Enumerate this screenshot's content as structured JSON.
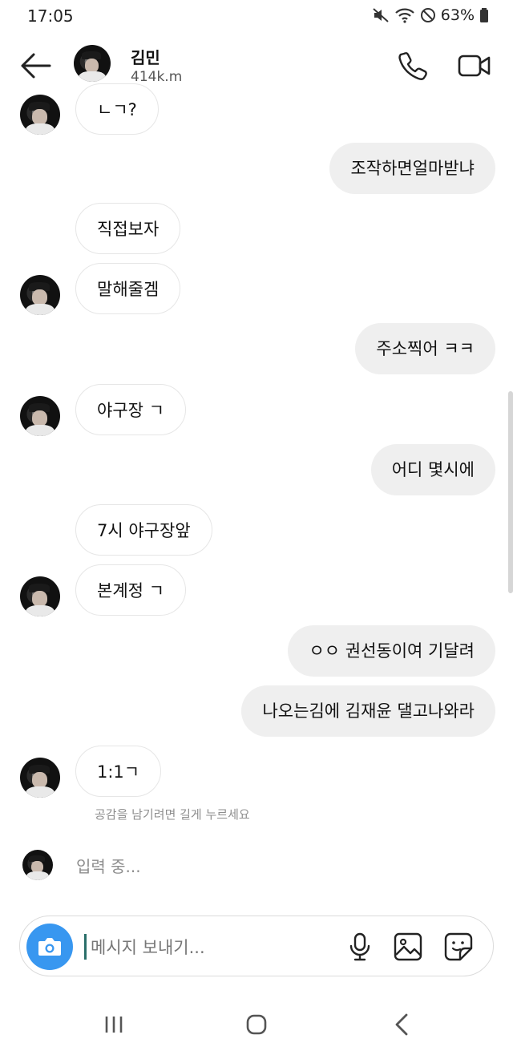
{
  "status": {
    "time": "17:05",
    "battery": "63%"
  },
  "header": {
    "name": "김민",
    "subtitle": "414k.m"
  },
  "messages": [
    {
      "dir": "in",
      "text": "ㄴㄱ?"
    },
    {
      "dir": "out",
      "text": "조작하면얼마받냐"
    },
    {
      "dir": "in",
      "text": "직접보자"
    },
    {
      "dir": "in",
      "text": "말해줄겜"
    },
    {
      "dir": "out",
      "text": "주소찍어 ㅋㅋ"
    },
    {
      "dir": "in",
      "text": "야구장 ㄱ"
    },
    {
      "dir": "out",
      "text": "어디 몇시에"
    },
    {
      "dir": "in",
      "text": "7시 야구장앞"
    },
    {
      "dir": "in",
      "text": "본계정 ㄱ"
    },
    {
      "dir": "out",
      "text": "ㅇㅇ 권선동이여 기달려"
    },
    {
      "dir": "out",
      "text": "나오는김에 김재윤 댈고나와라"
    },
    {
      "dir": "in",
      "text": "1:1ㄱ"
    }
  ],
  "hint": "공감을 남기려면 길게 누르세요",
  "typing": "입력 중...",
  "composer": {
    "placeholder": "메시지 보내기..."
  },
  "icons": {
    "back": "arrow-left-icon",
    "call": "phone-icon",
    "video": "video-camera-icon",
    "camera": "camera-icon",
    "mic": "microphone-icon",
    "gallery": "image-icon",
    "sticker": "sticker-icon"
  },
  "colors": {
    "accent": "#3897f0",
    "outgoing_bubble": "#efefef",
    "hint_text": "#8e8e8e"
  }
}
